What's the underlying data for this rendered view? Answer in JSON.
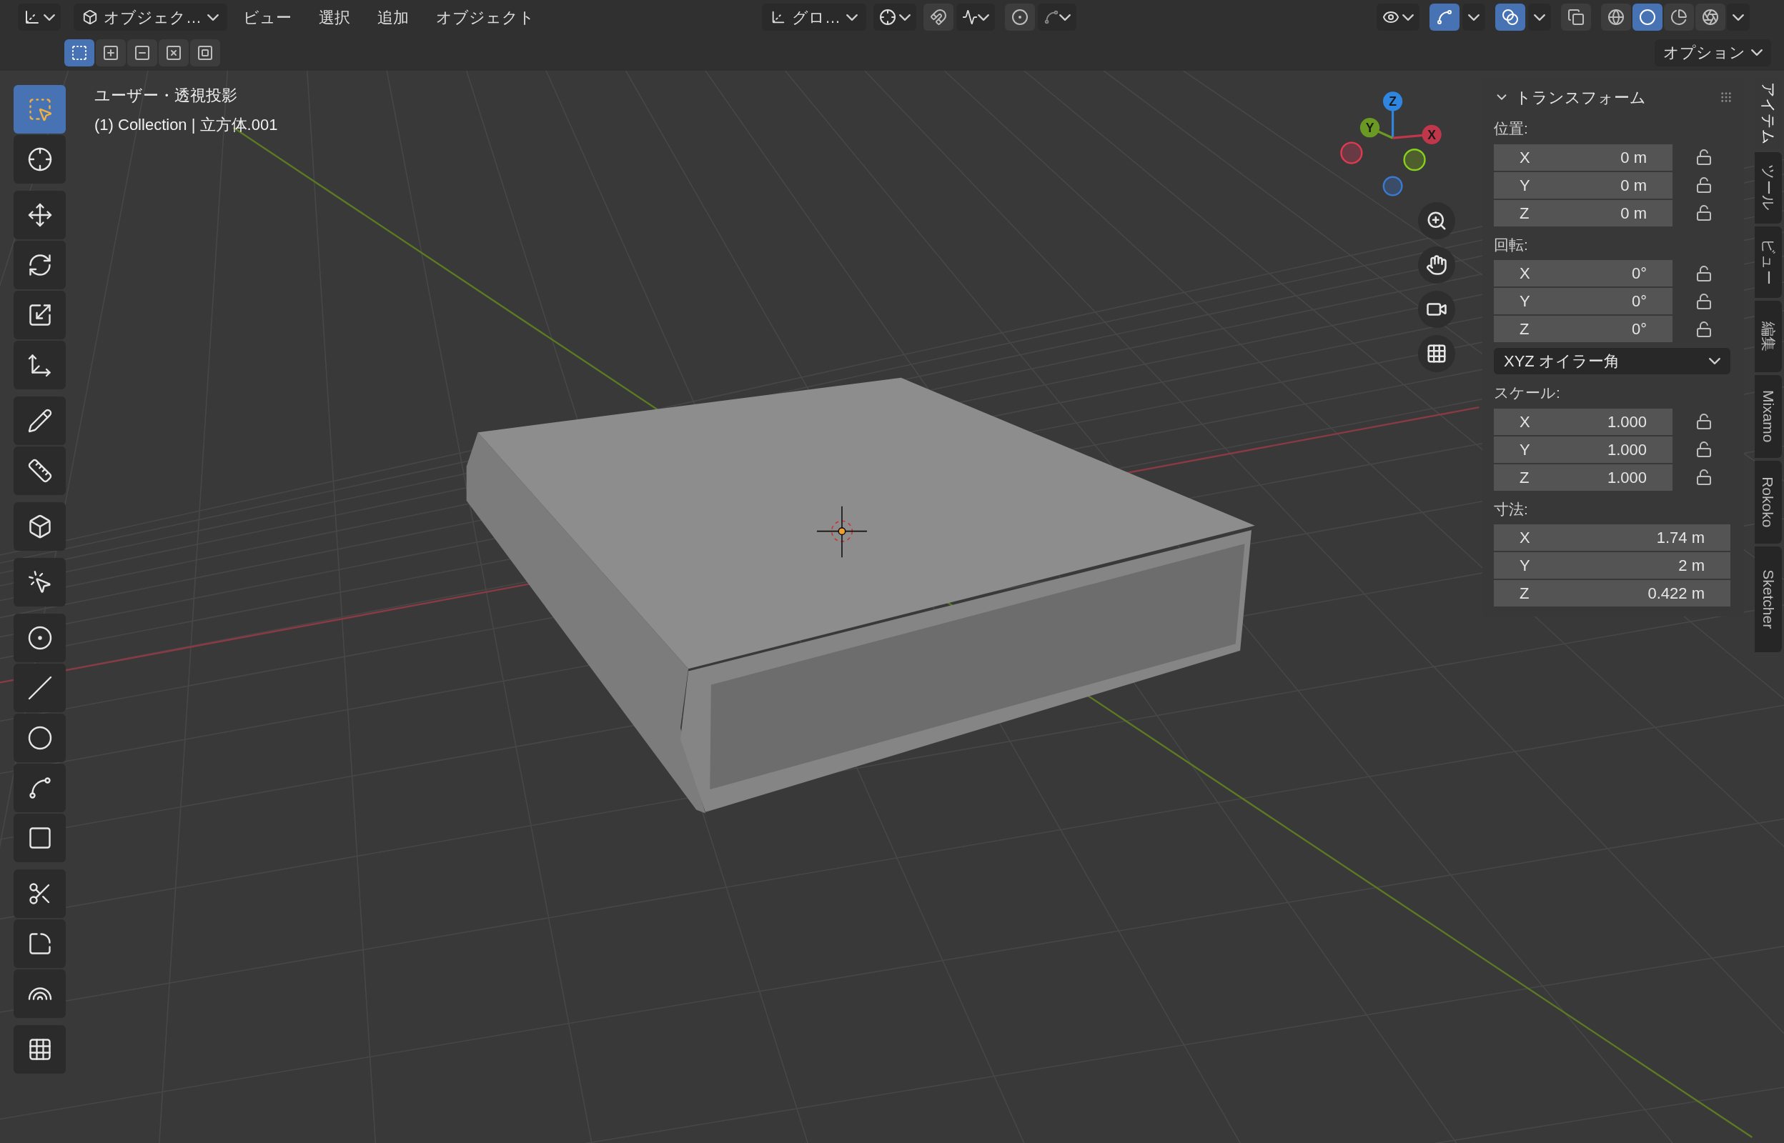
{
  "header": {
    "mode_label": "オブジェク…",
    "menus": [
      "ビュー",
      "選択",
      "追加",
      "オブジェクト"
    ],
    "orientation_label": "グロ…",
    "snap": {
      "on": false
    },
    "proportional": {
      "on": false
    },
    "gizmos": {
      "on": true
    },
    "overlays": {
      "on": true
    },
    "xray": {
      "on": false
    },
    "shading": [
      {
        "kind": "wireframe",
        "selected": false
      },
      {
        "kind": "solid",
        "selected": true
      },
      {
        "kind": "material",
        "selected": false
      },
      {
        "kind": "rendered",
        "selected": false
      }
    ],
    "select_modes": [
      {
        "kind": "set",
        "selected": true
      },
      {
        "kind": "extend",
        "selected": false
      },
      {
        "kind": "subtract",
        "selected": false
      },
      {
        "kind": "invert",
        "selected": false
      },
      {
        "kind": "intersect",
        "selected": false
      }
    ],
    "options_label": "オプション"
  },
  "viewport": {
    "view_name": "ユーザー・透視投影",
    "object_info": "(1) Collection | 立方体.001",
    "gizmo_axes": [
      {
        "label": "Z",
        "color": "#2e86e0"
      },
      {
        "label": "Y",
        "color": "#6a9a23"
      },
      {
        "label": "X",
        "color": "#c0374b"
      }
    ]
  },
  "toolbar": [
    [
      {
        "kind": "select-box",
        "selected": true
      },
      {
        "kind": "cursor",
        "selected": false
      }
    ],
    [
      {
        "kind": "move",
        "selected": false
      },
      {
        "kind": "rotate",
        "selected": false
      },
      {
        "kind": "scale",
        "selected": false
      },
      {
        "kind": "transform",
        "selected": false
      }
    ],
    [
      {
        "kind": "annotate",
        "selected": false
      },
      {
        "kind": "measure",
        "selected": false
      }
    ],
    [
      {
        "kind": "add-cube",
        "selected": false
      }
    ],
    [
      {
        "kind": "tweak",
        "selected": false
      }
    ],
    [
      {
        "kind": "add-point",
        "selected": false
      },
      {
        "kind": "add-line",
        "selected": false
      },
      {
        "kind": "add-circle",
        "selected": false
      },
      {
        "kind": "add-arc",
        "selected": false
      },
      {
        "kind": "add-rect",
        "selected": false
      }
    ],
    [
      {
        "kind": "knife",
        "selected": false
      },
      {
        "kind": "bevel",
        "selected": false
      },
      {
        "kind": "spin",
        "selected": false
      }
    ],
    [
      {
        "kind": "add-grid",
        "selected": false
      }
    ]
  ],
  "sidebar": {
    "tabs": [
      {
        "label": "アイテム",
        "selected": true
      },
      {
        "label": "ツール",
        "selected": false
      },
      {
        "label": "ビュー",
        "selected": false
      },
      {
        "label": "編集",
        "selected": false
      },
      {
        "label": "Mixamo",
        "selected": false
      },
      {
        "label": "Rokoko",
        "selected": false
      },
      {
        "label": "Sketcher",
        "selected": false
      }
    ],
    "panel": {
      "title": "トランスフォーム",
      "expanded": true,
      "groups": [
        {
          "label": "位置:",
          "fields": [
            {
              "axis": "X",
              "value": "0 m",
              "locked": false
            },
            {
              "axis": "Y",
              "value": "0 m",
              "locked": false
            },
            {
              "axis": "Z",
              "value": "0 m",
              "locked": false
            }
          ]
        },
        {
          "label": "回転:",
          "fields": [
            {
              "axis": "X",
              "value": "0°",
              "locked": false
            },
            {
              "axis": "Y",
              "value": "0°",
              "locked": false
            },
            {
              "axis": "Z",
              "value": "0°",
              "locked": false
            }
          ],
          "mode": "XYZ オイラー角"
        },
        {
          "label": "スケール:",
          "fields": [
            {
              "axis": "X",
              "value": "1.000",
              "locked": false
            },
            {
              "axis": "Y",
              "value": "1.000",
              "locked": false
            },
            {
              "axis": "Z",
              "value": "1.000",
              "locked": false
            }
          ]
        },
        {
          "label": "寸法:",
          "fields": [
            {
              "axis": "X",
              "value": "1.74 m"
            },
            {
              "axis": "Y",
              "value": "2 m"
            },
            {
              "axis": "Z",
              "value": "0.422 m"
            }
          ]
        }
      ]
    }
  }
}
